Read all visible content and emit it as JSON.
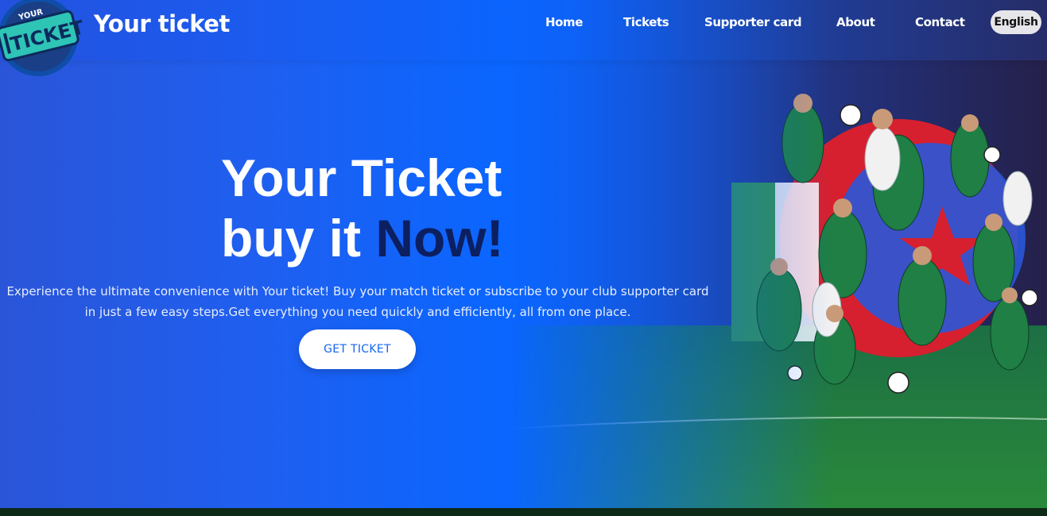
{
  "header": {
    "brand": "Your ticket",
    "logo": {
      "top_text": "YOUR",
      "main_text": "TICKET"
    },
    "nav": [
      {
        "label": "Home"
      },
      {
        "label": "Tickets"
      },
      {
        "label": "Supporter card"
      },
      {
        "label": "About"
      },
      {
        "label": "Contact"
      }
    ],
    "language": "English"
  },
  "hero": {
    "headline_line1": "Your Ticket",
    "headline_line2_prefix": "buy it ",
    "headline_line2_accent": "Now!",
    "description": "Experience the ultimate convenience with Your ticket! Buy your match ticket or subscribe to your club supporter card in just a few easy steps.Get everything you need quickly and efficiently, all from one place.",
    "cta_label": "GET TICKET"
  },
  "colors": {
    "primary": "#0a66ff",
    "accent_dark": "#0c1f60",
    "logo_teal": "#2ec4b6",
    "pitch_green": "#1f7a3a",
    "flag_red": "#d6202f"
  }
}
